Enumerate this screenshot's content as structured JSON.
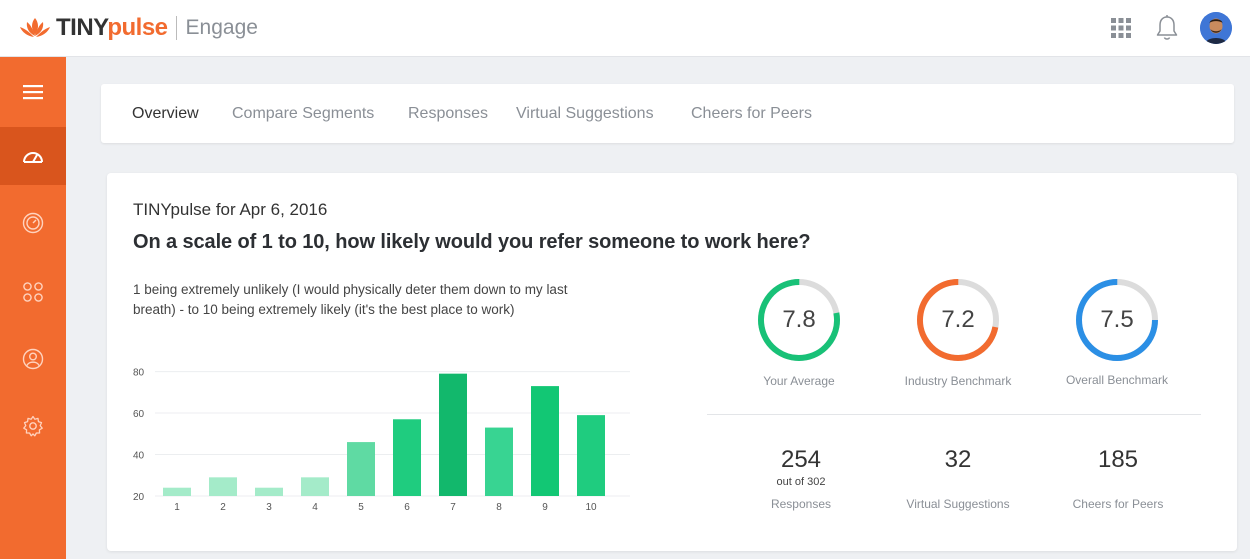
{
  "brand": {
    "name_part1": "TINY",
    "name_part2": "pulse",
    "product": "Engage"
  },
  "colors": {
    "accent": "#f26b2f",
    "sidebar_active": "#d9551d",
    "green": "#18c177",
    "orange": "#f26b2f",
    "blue": "#2b8fe5",
    "track": "#dcdcdc"
  },
  "header": {
    "icons": [
      "apps-grid-icon",
      "bell-icon",
      "user-avatar"
    ]
  },
  "sidebar": {
    "items": [
      "menu-icon",
      "dashboard-icon",
      "gauge-icon",
      "groups-icon",
      "user-icon",
      "settings-icon"
    ]
  },
  "tabs": [
    {
      "label": "Overview",
      "active": true
    },
    {
      "label": "Compare Segments",
      "active": false
    },
    {
      "label": "Responses",
      "active": false
    },
    {
      "label": "Virtual Suggestions",
      "active": false
    },
    {
      "label": "Cheers for Peers",
      "active": false
    }
  ],
  "card": {
    "date_title": "TINYpulse for Apr 6, 2016",
    "question": "On a scale of 1 to 10, how likely would you refer someone to work here?",
    "description": "1 being extremely unlikely (I would physically deter them down to my last breath) - to 10 being extremely likely (it's the best place to work)"
  },
  "chart_data": {
    "type": "bar",
    "categories": [
      "1",
      "2",
      "3",
      "4",
      "5",
      "6",
      "7",
      "8",
      "9",
      "10"
    ],
    "values": [
      24,
      29,
      24,
      29,
      46,
      57,
      79,
      53,
      73,
      59
    ],
    "yticks": [
      "20",
      "40",
      "60",
      "80"
    ],
    "ylim": [
      20,
      88
    ],
    "grid": true,
    "colors": [
      "#a4ebc9",
      "#a4ebc9",
      "#a4ebc9",
      "#a4ebc9",
      "#5fdaa3",
      "#1fcc7f",
      "#12b86c",
      "#38d492",
      "#12c774",
      "#1fcc7f"
    ]
  },
  "gauges": [
    {
      "value": "7.8",
      "fraction": 0.78,
      "label": "Your Average",
      "color": "#18c177"
    },
    {
      "value": "7.2",
      "fraction": 0.72,
      "label": "Industry Benchmark",
      "color": "#f26b2f"
    },
    {
      "value": "7.5",
      "fraction": 0.75,
      "label": "Overall Benchmark",
      "color": "#2b8fe5"
    }
  ],
  "stats": [
    {
      "value": "254",
      "sub": "out of 302",
      "label": "Responses"
    },
    {
      "value": "32",
      "sub": "",
      "label": "Virtual Suggestions"
    },
    {
      "value": "185",
      "sub": "",
      "label": "Cheers for Peers"
    }
  ]
}
